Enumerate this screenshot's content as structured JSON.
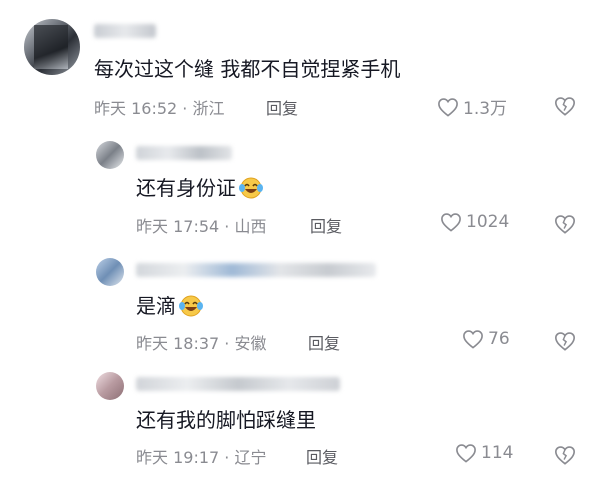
{
  "comments": [
    {
      "text": "每次过这个缝 我都不自觉捏紧手机",
      "emoji": "",
      "time": "昨天 16:52",
      "location": "· 浙江",
      "reply_label": "回复",
      "likes": "1.3万"
    },
    {
      "text": "还有身份证",
      "emoji": "crying-laughing-emoji",
      "time": "昨天 17:54",
      "location": "· 山西",
      "reply_label": "回复",
      "likes": "1024"
    },
    {
      "text": "是滴",
      "emoji": "crying-laughing-emoji",
      "time": "昨天 18:37",
      "location": "· 安徽",
      "reply_label": "回复",
      "likes": "76"
    },
    {
      "text": "还有我的脚怕踩缝里",
      "emoji": "",
      "time": "昨天 19:17",
      "location": "· 辽宁",
      "reply_label": "回复",
      "likes": "114"
    }
  ],
  "icons": {
    "like": "heart-outline-icon",
    "dislike": "broken-heart-icon"
  },
  "colors": {
    "text": "#161823",
    "meta": "#8a8b91"
  }
}
